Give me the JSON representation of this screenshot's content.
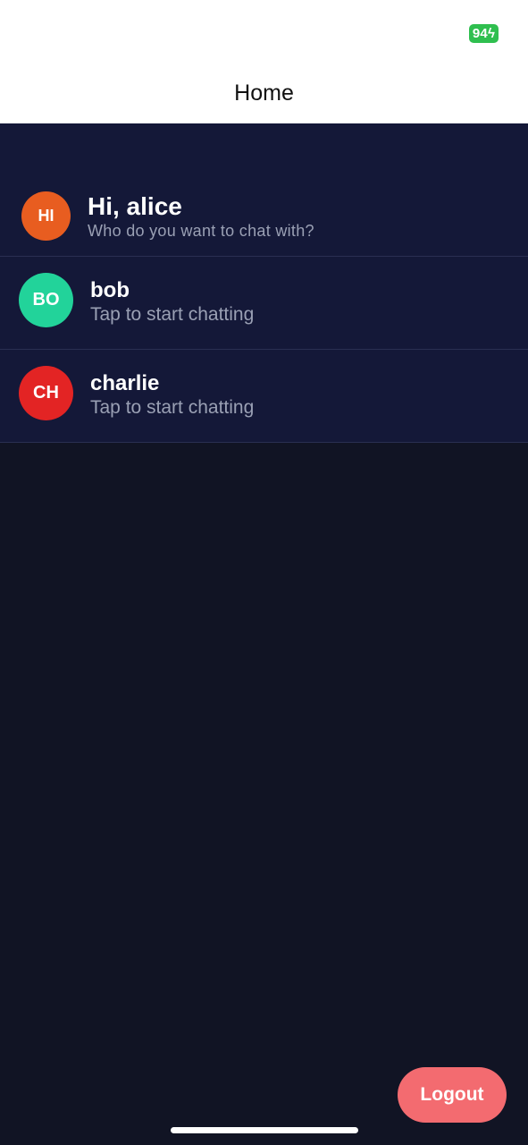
{
  "status_bar": {
    "battery_level": "94"
  },
  "header": {
    "title": "Home"
  },
  "greeting": {
    "avatar_initials": "HI",
    "avatar_color": "#e85d20",
    "title": "Hi, alice",
    "subtitle": "Who do you want to chat with?"
  },
  "contacts": [
    {
      "initials": "BO",
      "name": "bob",
      "subtitle": "Tap to start chatting",
      "color": "#22d39a"
    },
    {
      "initials": "CH",
      "name": "charlie",
      "subtitle": "Tap to start chatting",
      "color": "#e32424"
    }
  ],
  "logout": {
    "label": "Logout",
    "color": "#f36b70"
  },
  "colors": {
    "background": "#111424",
    "list_background": "#141838",
    "divider": "#2a2f52",
    "subtitle_text": "#9aa0b4",
    "battery": "#2fbf4f"
  }
}
